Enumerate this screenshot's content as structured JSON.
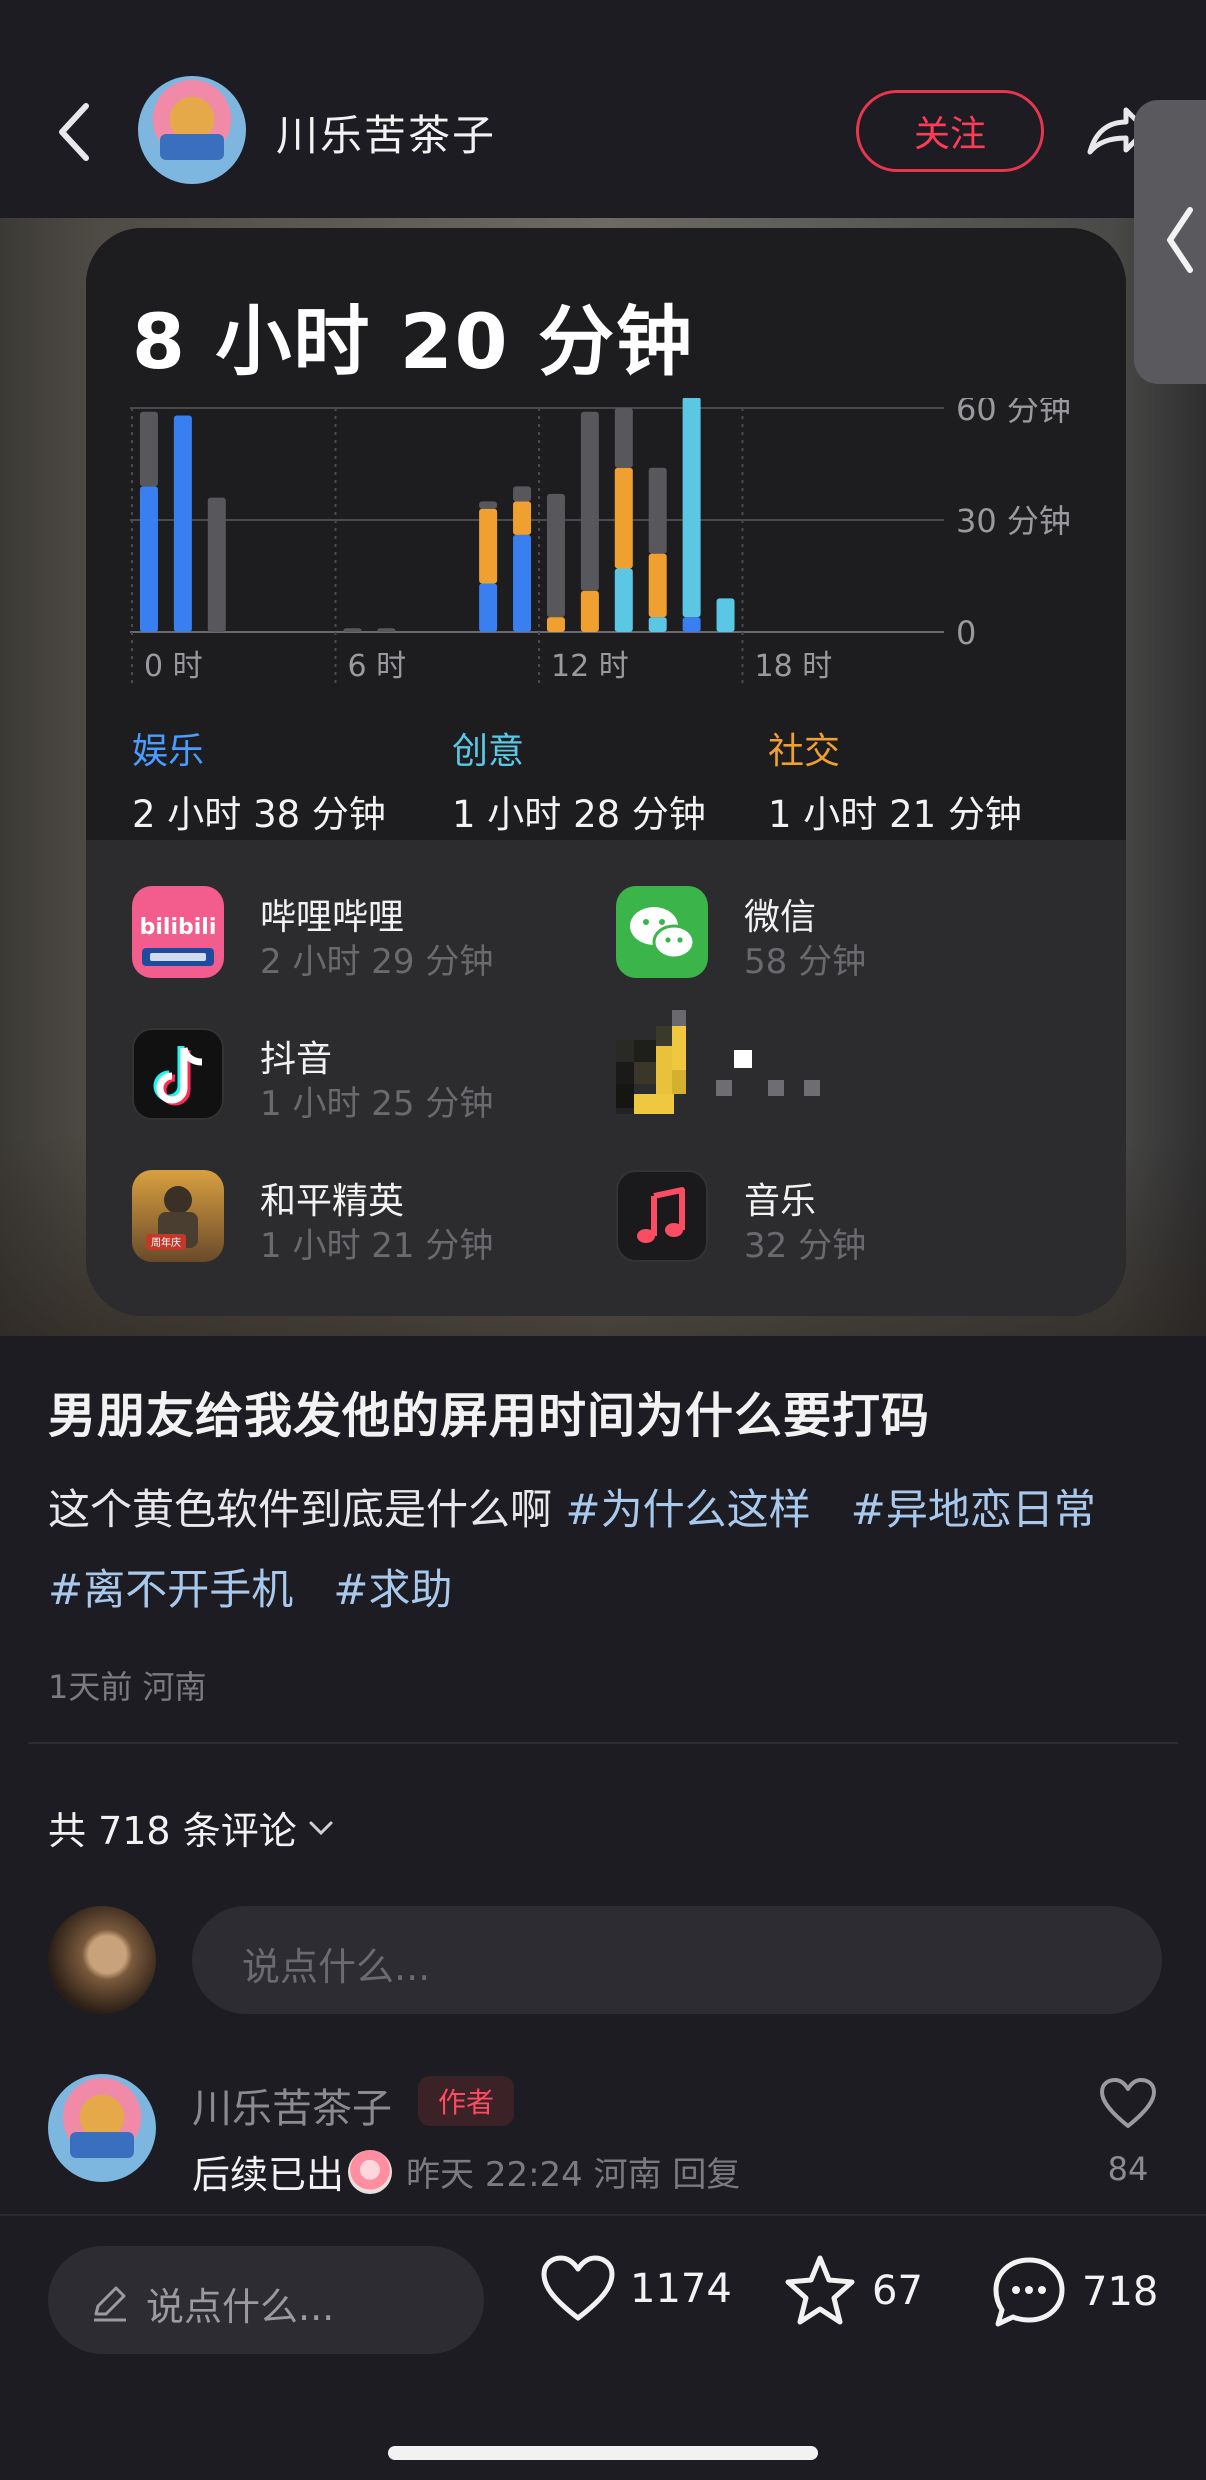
{
  "header": {
    "username": "川乐苦茶子",
    "follow_label": "关注"
  },
  "screen_time": {
    "total": "8 小时 20 分钟",
    "y_ticks": [
      "60 分钟",
      "30 分钟",
      "0"
    ],
    "x_ticks": [
      "0 时",
      "6 时",
      "12 时",
      "18 时"
    ],
    "categories": [
      {
        "name": "娱乐",
        "time": "2 小时 38 分钟",
        "color": "#4a9cff"
      },
      {
        "name": "创意",
        "time": "1 小时 28 分钟",
        "color": "#5ac8e4"
      },
      {
        "name": "社交",
        "time": "1 小时 21 分钟",
        "color": "#f0a030"
      }
    ],
    "apps": [
      {
        "name": "哔哩哔哩",
        "time": "2 小时 29 分钟",
        "icon": "bilibili-icon"
      },
      {
        "name": "微信",
        "time": "58 分钟",
        "icon": "wechat-icon"
      },
      {
        "name": "抖音",
        "time": "1 小时 25 分钟",
        "icon": "douyin-icon"
      },
      {
        "name": "",
        "time": "",
        "icon": "pixelated-icon"
      },
      {
        "name": "和平精英",
        "time": "1 小时 21 分钟",
        "icon": "game-icon"
      },
      {
        "name": "音乐",
        "time": "32 分钟",
        "icon": "music-icon"
      }
    ]
  },
  "chart_data": {
    "type": "bar",
    "stacked": true,
    "ylabel": "",
    "ylim": [
      0,
      60
    ],
    "yticks": [
      "60 分钟",
      "30 分钟",
      "0"
    ],
    "xticks": [
      "0 时",
      "6 时",
      "12 时",
      "18 时"
    ],
    "x": [
      0,
      1,
      2,
      3,
      4,
      5,
      6,
      7,
      8,
      9,
      10,
      11,
      12,
      13,
      14,
      15,
      16,
      17,
      18,
      19,
      20,
      21,
      22,
      23
    ],
    "series": [
      {
        "name": "娱乐",
        "color": "#3a7ff0",
        "values": [
          39,
          58,
          0,
          0,
          0,
          0,
          0,
          0,
          0,
          0,
          13,
          26,
          0,
          0,
          0,
          0,
          4,
          0,
          0,
          0,
          0,
          0,
          0,
          0
        ]
      },
      {
        "name": "创意",
        "color": "#5ac8e4",
        "values": [
          0,
          0,
          0,
          0,
          0,
          0,
          0,
          0,
          0,
          0,
          0,
          0,
          0,
          0,
          17,
          4,
          59,
          9,
          0,
          0,
          0,
          0,
          0,
          0
        ]
      },
      {
        "name": "社交",
        "color": "#f0a030",
        "values": [
          0,
          0,
          0,
          0,
          0,
          0,
          0,
          0,
          0,
          0,
          20,
          9,
          4,
          11,
          27,
          17,
          0,
          0,
          0,
          0,
          0,
          0,
          0,
          0
        ]
      },
      {
        "color": "#58585c",
        "values": [
          20,
          0,
          36,
          0,
          0,
          0,
          1,
          1,
          0,
          0,
          2,
          4,
          33,
          48,
          16,
          23,
          0,
          0,
          0,
          0,
          0,
          0,
          0,
          0
        ]
      }
    ]
  },
  "post": {
    "title": "男朋友给我发他的屏用时间为什么要打码",
    "body": "这个黄色软件到底是什么啊",
    "tags": [
      "#为什么这样",
      "#异地恋日常",
      "#离不开手机",
      "#求助"
    ],
    "meta": "1天前 河南"
  },
  "comments": {
    "count_label": "共 718 条评论",
    "input_placeholder": "说点什么...",
    "items": [
      {
        "user": "川乐苦茶子",
        "badge": "作者",
        "text": "后续已出",
        "meta": "昨天 22:24 河南 回复",
        "likes": "84"
      }
    ]
  },
  "bottom_bar": {
    "input_placeholder": "说点什么...",
    "likes": "1174",
    "stars": "67",
    "comments": "718"
  }
}
